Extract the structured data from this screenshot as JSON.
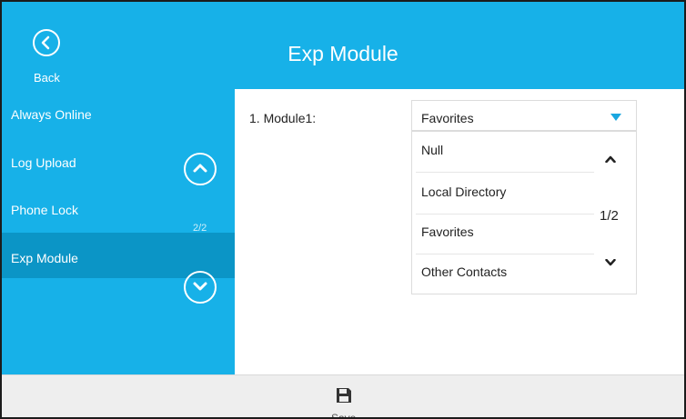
{
  "header": {
    "title": "Exp Module",
    "back_label": "Back"
  },
  "sidebar": {
    "items": [
      {
        "label": "Always Online"
      },
      {
        "label": "Log Upload"
      },
      {
        "label": "Phone Lock"
      },
      {
        "label": "Exp Module"
      }
    ],
    "active_item": "Exp Module",
    "page_indicator": "2/2"
  },
  "main": {
    "field_label": "1. Module1:",
    "selected_value": "Favorites",
    "dropdown": {
      "options": [
        {
          "label": "Null"
        },
        {
          "label": "Local Directory"
        },
        {
          "label": "Favorites"
        },
        {
          "label": "Other Contacts"
        }
      ],
      "page_indicator": "1/2"
    }
  },
  "footer": {
    "save_label": "Save"
  },
  "colors": {
    "accent": "#17b1e8",
    "sidebar_active": "#0b95c6",
    "caret": "#1aa7e0"
  },
  "icons": {
    "back": "back-arrow-circle-icon",
    "up": "chevron-up-circle-icon",
    "down": "chevron-down-circle-icon",
    "save": "floppy-disk-icon"
  }
}
